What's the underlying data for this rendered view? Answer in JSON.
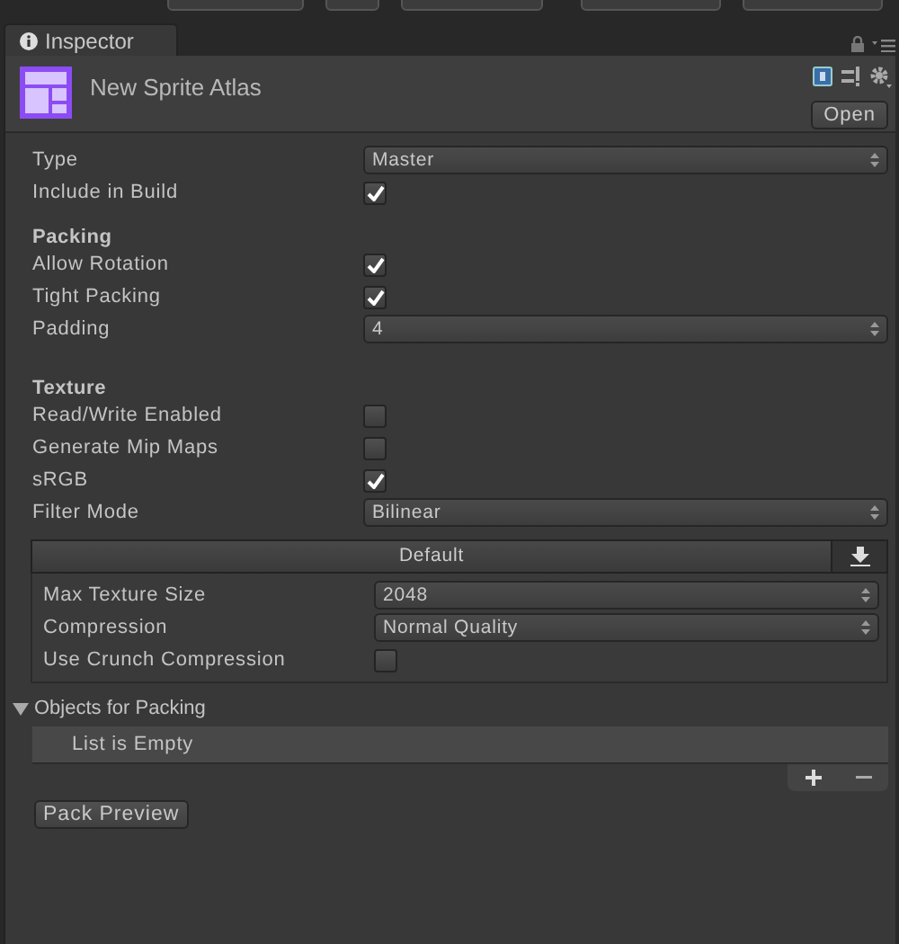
{
  "tab": {
    "label": "Inspector"
  },
  "asset": {
    "name": "New Sprite Atlas",
    "open_button": "Open"
  },
  "properties": [
    {
      "kind": "dropdown",
      "label": "Type",
      "value": "Master"
    },
    {
      "kind": "checkbox",
      "label": "Include in Build",
      "checked": true
    },
    {
      "kind": "heading",
      "label": "Packing"
    },
    {
      "kind": "checkbox",
      "label": "Allow Rotation",
      "checked": true
    },
    {
      "kind": "checkbox",
      "label": "Tight Packing",
      "checked": true
    },
    {
      "kind": "dropdown",
      "label": "Padding",
      "value": "4"
    },
    {
      "kind": "heading",
      "label": "Texture"
    },
    {
      "kind": "checkbox",
      "label": "Read/Write Enabled",
      "checked": false
    },
    {
      "kind": "checkbox",
      "label": "Generate Mip Maps",
      "checked": false
    },
    {
      "kind": "checkbox",
      "label": "sRGB",
      "checked": true
    },
    {
      "kind": "dropdown",
      "label": "Filter Mode",
      "value": "Bilinear"
    }
  ],
  "platform": {
    "tab": "Default",
    "settings": [
      {
        "kind": "dropdown",
        "label": "Max Texture Size",
        "value": "2048"
      },
      {
        "kind": "dropdown",
        "label": "Compression",
        "value": "Normal Quality"
      },
      {
        "kind": "checkbox",
        "label": "Use Crunch Compression",
        "checked": false
      }
    ]
  },
  "objects": {
    "title": "Objects for Packing",
    "expanded": true,
    "empty_text": "List is Empty"
  },
  "pack_button": "Pack Preview"
}
